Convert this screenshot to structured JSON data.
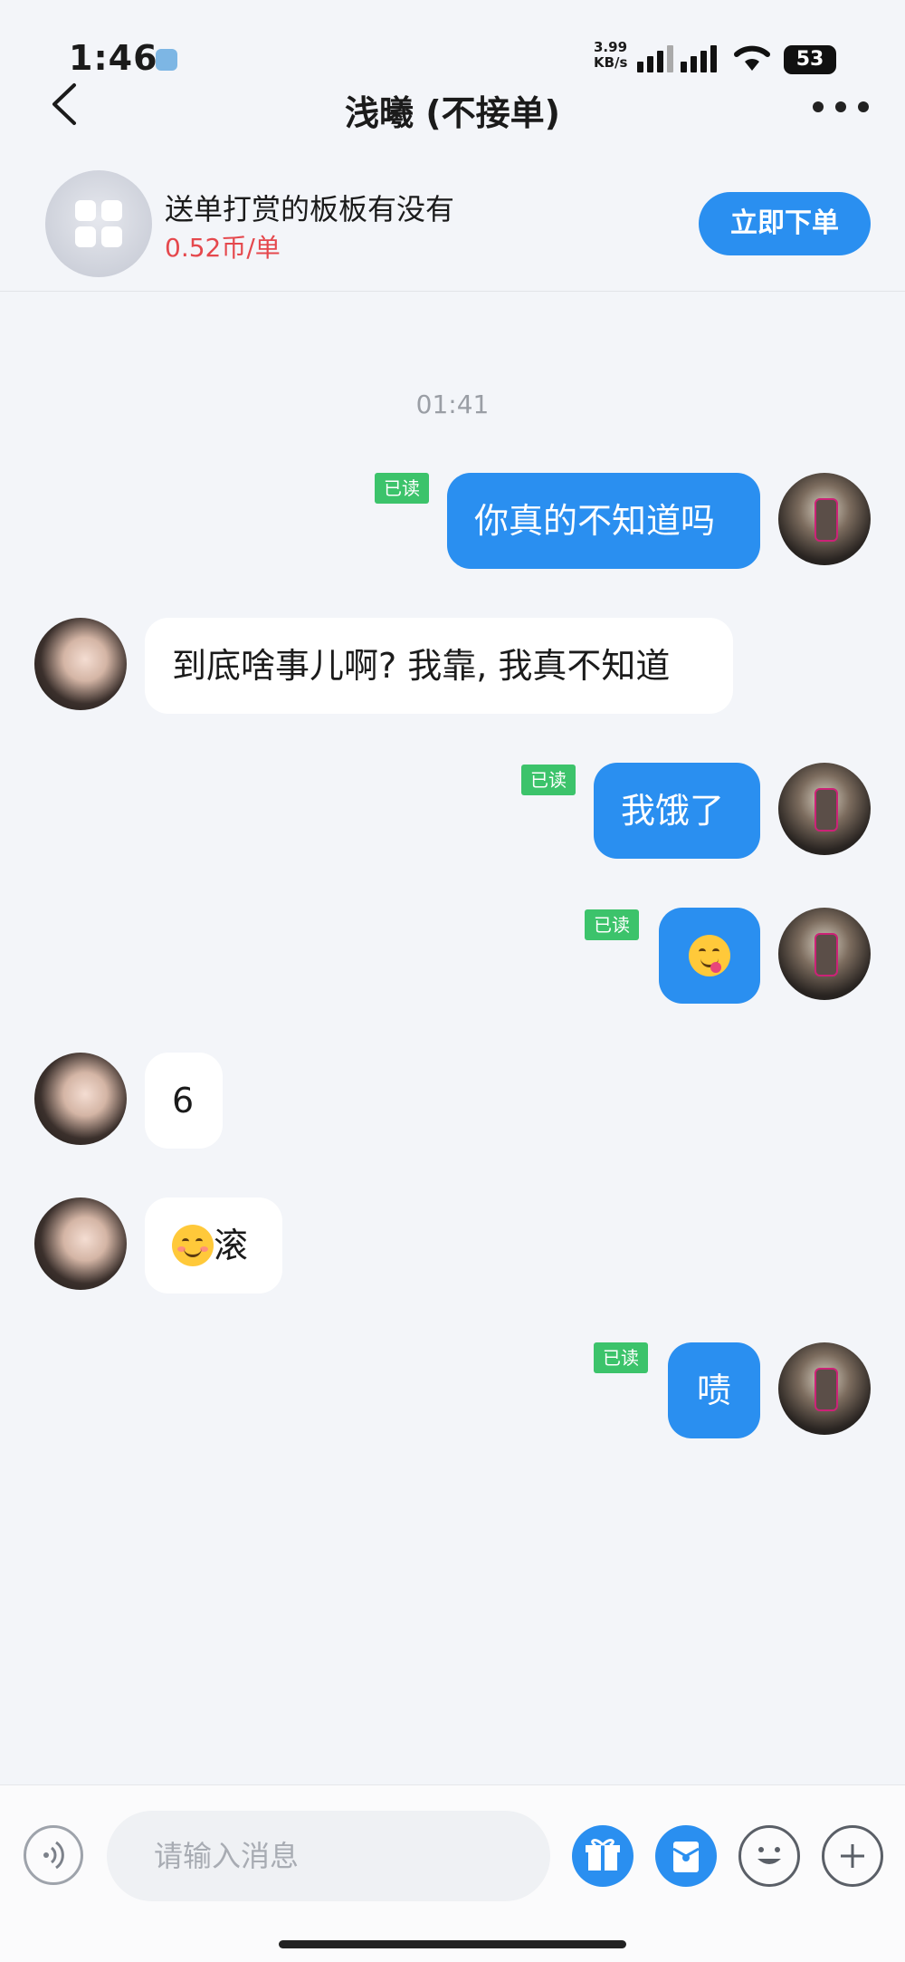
{
  "status_bar": {
    "time": "1:46",
    "net_speed_value": "3.99",
    "net_speed_unit": "KB/s",
    "battery": "53"
  },
  "header": {
    "title": "浅曦 (不接单)",
    "back_icon": "chevron-left-icon",
    "more_icon": "more-dots-icon"
  },
  "order_card": {
    "name": "送单打赏的板板有没有",
    "price": "0.52币/单",
    "cta_label": "立即下单",
    "price_color": "#e5484d",
    "accent": "#2a8ff0"
  },
  "chat": {
    "timestamp": "01:41",
    "read_label": "已读",
    "messages": [
      {
        "side": "out",
        "text": "你真的不知道吗",
        "read": true
      },
      {
        "side": "in",
        "text": "到底啥事儿啊? 我靠, 我真不知道"
      },
      {
        "side": "out",
        "text": "我饿了",
        "read": true
      },
      {
        "side": "out",
        "emoji": "face-savoring-food",
        "read": true
      },
      {
        "side": "in",
        "text": "6"
      },
      {
        "side": "in",
        "emoji": "smiling-face",
        "text": "滚"
      },
      {
        "side": "out",
        "text": "啧",
        "read": true
      }
    ]
  },
  "input_bar": {
    "placeholder": "请输入消息",
    "icons": [
      "voice-icon",
      "gift-icon",
      "red-packet-icon",
      "emoji-icon",
      "plus-icon"
    ]
  }
}
